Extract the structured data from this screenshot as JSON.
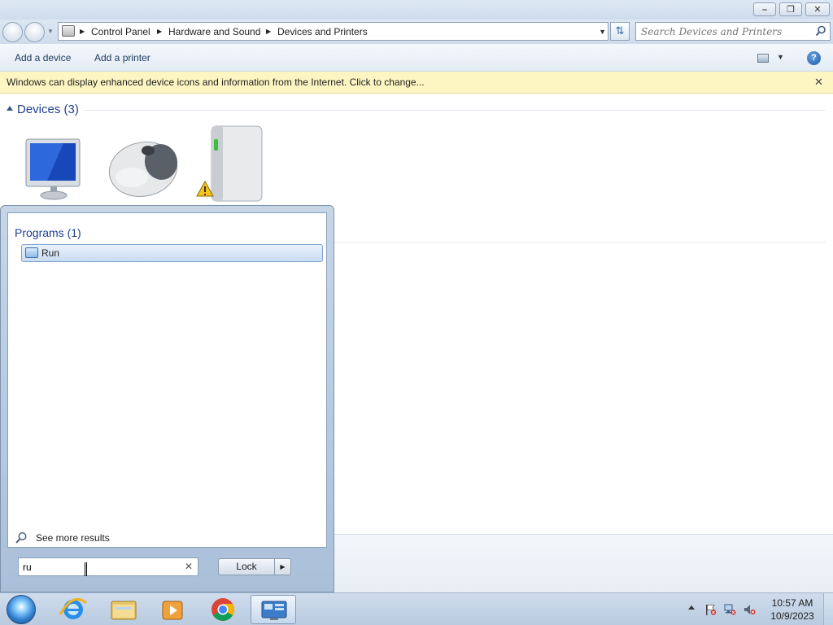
{
  "window": {
    "minimize_icon": "minimize-icon",
    "restore_icon": "restore-icon",
    "close_icon": "close-icon"
  },
  "address": {
    "breadcrumbs": [
      "Control Panel",
      "Hardware and Sound",
      "Devices and Printers"
    ],
    "search_placeholder": "Search Devices and Printers"
  },
  "toolbar": {
    "add_device": "Add a device",
    "add_printer": "Add a printer"
  },
  "info_bar": {
    "text": "Windows can display enhanced device icons and information from the Internet. Click to change..."
  },
  "devices": {
    "title": "Devices (3)",
    "items": [
      {
        "icon": "monitor-icon"
      },
      {
        "icon": "mouse-icon"
      },
      {
        "icon": "external-drive-icon",
        "warning": true
      }
    ]
  },
  "start_menu": {
    "programs_title": "Programs (1)",
    "programs": [
      {
        "label": "Run",
        "icon": "run-icon"
      }
    ],
    "see_more": "See more results",
    "search_value": "ru",
    "lock_label": "Lock"
  },
  "taskbar": {
    "apps": [
      "internet-explorer-icon",
      "file-explorer-icon",
      "media-player-icon",
      "chrome-icon",
      "devices-and-printers-icon"
    ],
    "time": "10:57 AM",
    "date": "10/9/2023"
  },
  "colors": {
    "accent": "#1e3f91",
    "info_bar_bg": "#fdf6c3",
    "selection": "#c9dcf2"
  }
}
